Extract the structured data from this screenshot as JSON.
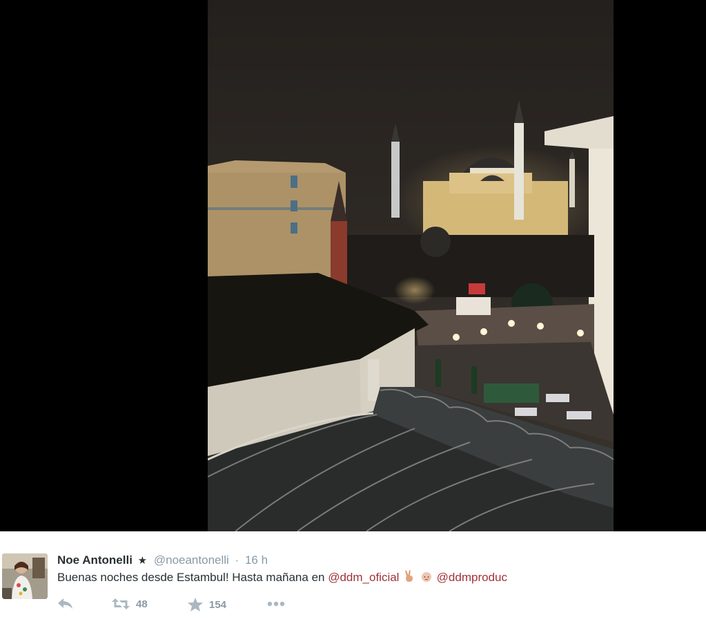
{
  "tweet": {
    "author_name": "Noe Antonelli",
    "verified_star": "★",
    "handle": "@noeantonelli",
    "separator": "·",
    "time": "16 h",
    "text_before": "Buenas noches desde Estambul! Hasta mañana en",
    "mention_1": "@ddm_oficial",
    "mention_2": "@ddmproduc",
    "emoji_1": "victory-hand",
    "emoji_2": "grinning-face",
    "retweet_count": "48",
    "favorite_count": "154"
  },
  "colors": {
    "name": "#292f33",
    "meta": "#8899a6",
    "mention": "#a0333a",
    "action_icon": "#aab8c2"
  },
  "icons": {
    "reply": "reply-icon",
    "retweet": "retweet-icon",
    "favorite": "star-icon",
    "more": "more-dots-icon"
  }
}
